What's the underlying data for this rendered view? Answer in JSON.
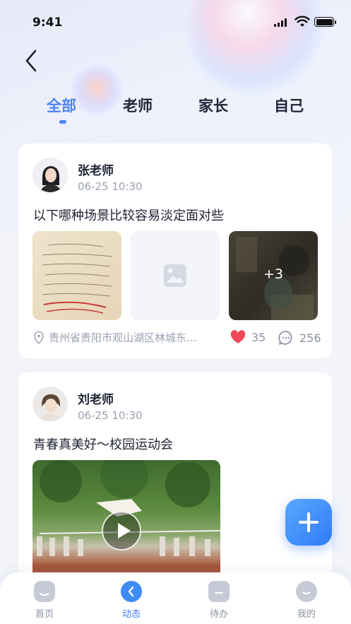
{
  "status_bar": {
    "time": "9:41"
  },
  "tabs": [
    {
      "label": "全部",
      "active": true
    },
    {
      "label": "老师",
      "active": false
    },
    {
      "label": "家长",
      "active": false
    },
    {
      "label": "自己",
      "active": false
    }
  ],
  "posts": [
    {
      "author": "张老师",
      "date": "06-25 10:30",
      "content": "以下哪种场景比较容易淡定面对些",
      "more_images": "+3",
      "location": "贵州省贵阳市观山湖区林城东…",
      "likes": "35",
      "comments": "256"
    },
    {
      "author": "刘老师",
      "date": "06-25 10:30",
      "content": "青春真美好～校园运动会"
    }
  ],
  "tabbar": [
    {
      "label": "首页",
      "icon": "home-icon",
      "active": false
    },
    {
      "label": "动态",
      "icon": "dynamic-icon",
      "active": true
    },
    {
      "label": "待办",
      "icon": "todo-icon",
      "active": false
    },
    {
      "label": "我的",
      "icon": "profile-icon",
      "active": false
    }
  ],
  "colors": {
    "accent": "#4c84f6",
    "like": "#f0475a",
    "muted": "#9aa1b2"
  }
}
